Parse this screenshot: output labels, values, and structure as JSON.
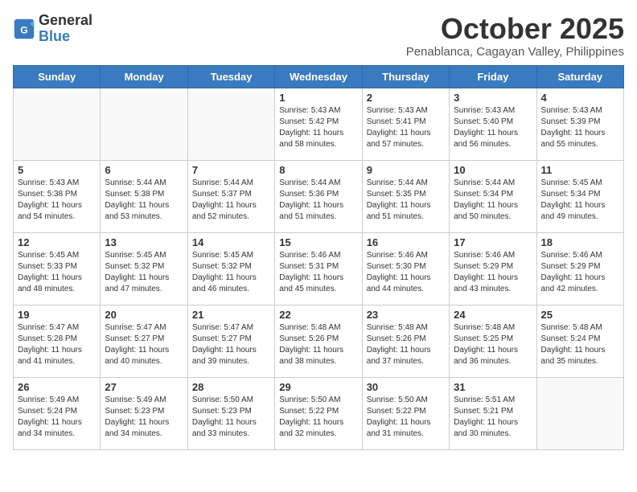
{
  "header": {
    "logo_general": "General",
    "logo_blue": "Blue",
    "month_title": "October 2025",
    "subtitle": "Penablanca, Cagayan Valley, Philippines"
  },
  "days_of_week": [
    "Sunday",
    "Monday",
    "Tuesday",
    "Wednesday",
    "Thursday",
    "Friday",
    "Saturday"
  ],
  "weeks": [
    [
      {
        "day": "",
        "info": ""
      },
      {
        "day": "",
        "info": ""
      },
      {
        "day": "",
        "info": ""
      },
      {
        "day": "1",
        "info": "Sunrise: 5:43 AM\nSunset: 5:42 PM\nDaylight: 11 hours\nand 58 minutes."
      },
      {
        "day": "2",
        "info": "Sunrise: 5:43 AM\nSunset: 5:41 PM\nDaylight: 11 hours\nand 57 minutes."
      },
      {
        "day": "3",
        "info": "Sunrise: 5:43 AM\nSunset: 5:40 PM\nDaylight: 11 hours\nand 56 minutes."
      },
      {
        "day": "4",
        "info": "Sunrise: 5:43 AM\nSunset: 5:39 PM\nDaylight: 11 hours\nand 55 minutes."
      }
    ],
    [
      {
        "day": "5",
        "info": "Sunrise: 5:43 AM\nSunset: 5:38 PM\nDaylight: 11 hours\nand 54 minutes."
      },
      {
        "day": "6",
        "info": "Sunrise: 5:44 AM\nSunset: 5:38 PM\nDaylight: 11 hours\nand 53 minutes."
      },
      {
        "day": "7",
        "info": "Sunrise: 5:44 AM\nSunset: 5:37 PM\nDaylight: 11 hours\nand 52 minutes."
      },
      {
        "day": "8",
        "info": "Sunrise: 5:44 AM\nSunset: 5:36 PM\nDaylight: 11 hours\nand 51 minutes."
      },
      {
        "day": "9",
        "info": "Sunrise: 5:44 AM\nSunset: 5:35 PM\nDaylight: 11 hours\nand 51 minutes."
      },
      {
        "day": "10",
        "info": "Sunrise: 5:44 AM\nSunset: 5:34 PM\nDaylight: 11 hours\nand 50 minutes."
      },
      {
        "day": "11",
        "info": "Sunrise: 5:45 AM\nSunset: 5:34 PM\nDaylight: 11 hours\nand 49 minutes."
      }
    ],
    [
      {
        "day": "12",
        "info": "Sunrise: 5:45 AM\nSunset: 5:33 PM\nDaylight: 11 hours\nand 48 minutes."
      },
      {
        "day": "13",
        "info": "Sunrise: 5:45 AM\nSunset: 5:32 PM\nDaylight: 11 hours\nand 47 minutes."
      },
      {
        "day": "14",
        "info": "Sunrise: 5:45 AM\nSunset: 5:32 PM\nDaylight: 11 hours\nand 46 minutes."
      },
      {
        "day": "15",
        "info": "Sunrise: 5:46 AM\nSunset: 5:31 PM\nDaylight: 11 hours\nand 45 minutes."
      },
      {
        "day": "16",
        "info": "Sunrise: 5:46 AM\nSunset: 5:30 PM\nDaylight: 11 hours\nand 44 minutes."
      },
      {
        "day": "17",
        "info": "Sunrise: 5:46 AM\nSunset: 5:29 PM\nDaylight: 11 hours\nand 43 minutes."
      },
      {
        "day": "18",
        "info": "Sunrise: 5:46 AM\nSunset: 5:29 PM\nDaylight: 11 hours\nand 42 minutes."
      }
    ],
    [
      {
        "day": "19",
        "info": "Sunrise: 5:47 AM\nSunset: 5:28 PM\nDaylight: 11 hours\nand 41 minutes."
      },
      {
        "day": "20",
        "info": "Sunrise: 5:47 AM\nSunset: 5:27 PM\nDaylight: 11 hours\nand 40 minutes."
      },
      {
        "day": "21",
        "info": "Sunrise: 5:47 AM\nSunset: 5:27 PM\nDaylight: 11 hours\nand 39 minutes."
      },
      {
        "day": "22",
        "info": "Sunrise: 5:48 AM\nSunset: 5:26 PM\nDaylight: 11 hours\nand 38 minutes."
      },
      {
        "day": "23",
        "info": "Sunrise: 5:48 AM\nSunset: 5:26 PM\nDaylight: 11 hours\nand 37 minutes."
      },
      {
        "day": "24",
        "info": "Sunrise: 5:48 AM\nSunset: 5:25 PM\nDaylight: 11 hours\nand 36 minutes."
      },
      {
        "day": "25",
        "info": "Sunrise: 5:48 AM\nSunset: 5:24 PM\nDaylight: 11 hours\nand 35 minutes."
      }
    ],
    [
      {
        "day": "26",
        "info": "Sunrise: 5:49 AM\nSunset: 5:24 PM\nDaylight: 11 hours\nand 34 minutes."
      },
      {
        "day": "27",
        "info": "Sunrise: 5:49 AM\nSunset: 5:23 PM\nDaylight: 11 hours\nand 34 minutes."
      },
      {
        "day": "28",
        "info": "Sunrise: 5:50 AM\nSunset: 5:23 PM\nDaylight: 11 hours\nand 33 minutes."
      },
      {
        "day": "29",
        "info": "Sunrise: 5:50 AM\nSunset: 5:22 PM\nDaylight: 11 hours\nand 32 minutes."
      },
      {
        "day": "30",
        "info": "Sunrise: 5:50 AM\nSunset: 5:22 PM\nDaylight: 11 hours\nand 31 minutes."
      },
      {
        "day": "31",
        "info": "Sunrise: 5:51 AM\nSunset: 5:21 PM\nDaylight: 11 hours\nand 30 minutes."
      },
      {
        "day": "",
        "info": ""
      }
    ]
  ]
}
